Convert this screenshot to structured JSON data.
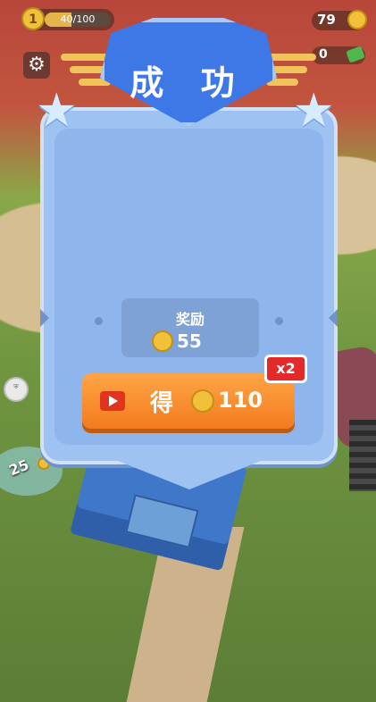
{
  "hud": {
    "level": "1",
    "level_progress": "40/100",
    "level_progress_fraction": 0.4,
    "coins": "79",
    "cash": "0"
  },
  "panel": {
    "title": "成 功",
    "reward_label": "奖励",
    "reward_amount": "55",
    "claim_label": "得",
    "claim_amount": "110",
    "multiplier": "x2"
  },
  "world": {
    "base_value": "25"
  },
  "colors": {
    "panel": "#9ec2f2",
    "shield": "#3e78e6",
    "button": "#f27b1e",
    "multiplier_badge": "#e22a2a",
    "coin": "#f2c13a"
  }
}
